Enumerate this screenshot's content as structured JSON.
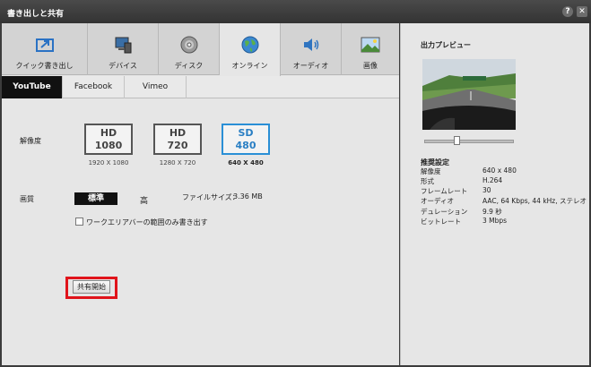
{
  "window": {
    "title": "書き出しと共有",
    "help_label": "?",
    "close_label": "✕"
  },
  "tabs": [
    {
      "label": "クイック書き出し",
      "icon": "quick-export-icon"
    },
    {
      "label": "デバイス",
      "icon": "device-icon"
    },
    {
      "label": "ディスク",
      "icon": "disc-icon"
    },
    {
      "label": "オンライン",
      "icon": "globe-icon"
    },
    {
      "label": "オーディオ",
      "icon": "speaker-icon"
    },
    {
      "label": "画像",
      "icon": "image-icon"
    }
  ],
  "subtabs": [
    "YouTube",
    "Facebook",
    "Vimeo"
  ],
  "resolution": {
    "label": "解像度",
    "options": [
      {
        "line1": "HD",
        "line2": "1080",
        "caption": "1920 X 1080"
      },
      {
        "line1": "HD",
        "line2": "720",
        "caption": "1280 X 720"
      },
      {
        "line1": "SD",
        "line2": "480",
        "caption": "640 X 480"
      }
    ],
    "selected": "SD 480"
  },
  "quality": {
    "label": "画質",
    "standard": "標準",
    "high": "高",
    "selected": "標準"
  },
  "filesize": {
    "label": "ファイルサイズ：",
    "value": "3.36 MB"
  },
  "workarea_checkbox": {
    "label": "ワークエリアバーの範囲のみ書き出す",
    "checked": false
  },
  "share_button": "共有開始",
  "preview": {
    "title": "出力プレビュー"
  },
  "settings": {
    "title": "推奨設定",
    "rows": [
      {
        "key": "解像度",
        "value": "640 x 480"
      },
      {
        "key": "形式",
        "value": "H.264"
      },
      {
        "key": "フレームレート",
        "value": "30"
      },
      {
        "key": "オーディオ",
        "value": "AAC, 64 Kbps, 44 kHz, ステレオ"
      },
      {
        "key": "デュレーション",
        "value": "9.9 秒"
      },
      {
        "key": "ビットレート",
        "value": "3 Mbps"
      }
    ]
  },
  "colors": {
    "selected_accent": "#2a8fd6",
    "highlight": "#e0141b"
  }
}
